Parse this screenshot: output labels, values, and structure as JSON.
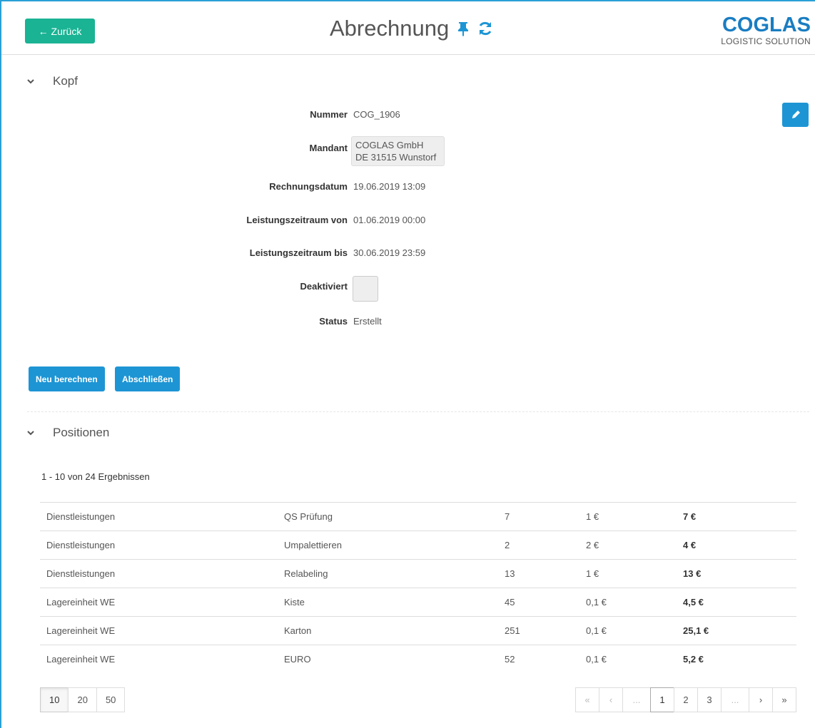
{
  "header": {
    "back_label": "← Zurück",
    "title": "Abrechnung",
    "logo_main": "COGLAS",
    "logo_sub": "LOGISTIC SOLUTION",
    "pin_icon": "pin-icon",
    "refresh_icon": "refresh-icon"
  },
  "kopf": {
    "section_title": "Kopf",
    "fields": {
      "nummer_label": "Nummer",
      "nummer_value": "COG_1906",
      "mandant_label": "Mandant",
      "mandant_line1": "COGLAS GmbH",
      "mandant_line2": "DE 31515 Wunstorf",
      "rechnungsdatum_label": "Rechnungsdatum",
      "rechnungsdatum_value": "19.06.2019 13:09",
      "von_label": "Leistungszeitraum von",
      "von_value": "01.06.2019 00:00",
      "bis_label": "Leistungszeitraum bis",
      "bis_value": "30.06.2019 23:59",
      "deaktiviert_label": "Deaktiviert",
      "deaktiviert_checked": false,
      "status_label": "Status",
      "status_value": "Erstellt"
    },
    "buttons": {
      "recalculate": "Neu berechnen",
      "finish": "Abschließen"
    }
  },
  "positionen": {
    "section_title": "Positionen",
    "results": "1 - 10 von 24 Ergebnissen",
    "rows": [
      [
        "Dienstleistungen",
        "QS Prüfung",
        "7",
        "1 €",
        "7 €"
      ],
      [
        "Dienstleistungen",
        "Umpalettieren",
        "2",
        "2 €",
        "4 €"
      ],
      [
        "Dienstleistungen",
        "Relabeling",
        "13",
        "1 €",
        "13 €"
      ],
      [
        "Lagereinheit WE",
        "Kiste",
        "45",
        "0,1 €",
        "4,5 €"
      ],
      [
        "Lagereinheit WE",
        "Karton",
        "251",
        "0,1 €",
        "25,1 €"
      ],
      [
        "Lagereinheit WE",
        "EURO",
        "52",
        "0,1 €",
        "5,2 €"
      ]
    ],
    "page_sizes": [
      "10",
      "20",
      "50"
    ],
    "active_page_size": "10",
    "pager": {
      "first": "«",
      "prev": "‹",
      "ellipsis_left": "...",
      "pages": [
        "1",
        "2",
        "3"
      ],
      "active_page": "1",
      "ellipsis_right": "...",
      "next": "›",
      "last": "»"
    }
  },
  "colors": {
    "accent": "#1d95d4",
    "back_button": "#1ab394",
    "frame": "#2a9fd6"
  }
}
